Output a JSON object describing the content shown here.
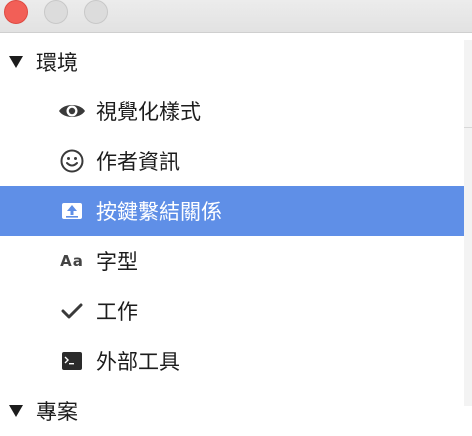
{
  "window": {
    "controls": [
      "close",
      "minimize",
      "zoom"
    ]
  },
  "sidebar": {
    "groups": [
      {
        "label": "環境",
        "expanded": true,
        "items": [
          {
            "label": "視覺化樣式",
            "icon": "eye-icon",
            "selected": false
          },
          {
            "label": "作者資訊",
            "icon": "smiley-icon",
            "selected": false
          },
          {
            "label": "按鍵繫結關係",
            "icon": "upload-tray-icon",
            "selected": true
          },
          {
            "label": "字型",
            "icon": "font-aa-icon",
            "selected": false
          },
          {
            "label": "工作",
            "icon": "checkmark-icon",
            "selected": false
          },
          {
            "label": "外部工具",
            "icon": "terminal-icon",
            "selected": false
          }
        ]
      },
      {
        "label": "專案",
        "expanded": true,
        "items": []
      }
    ],
    "font_sample_text": "Aa"
  },
  "colors": {
    "selection": "#5f8fe7",
    "close_button": "#f25f57",
    "inactive_button": "#dcdcdc"
  }
}
